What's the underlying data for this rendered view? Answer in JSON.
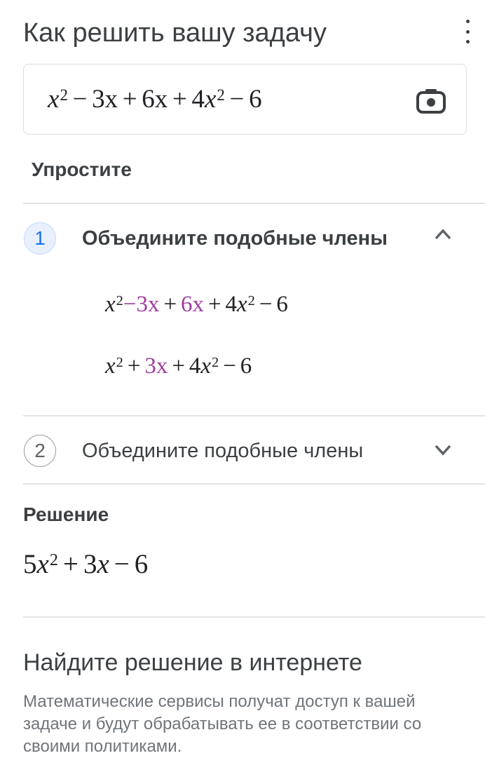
{
  "header": {
    "title": "Как решить вашу задачу",
    "menu_icon": "more-vert-icon"
  },
  "problem": {
    "input_icon": "camera-icon",
    "terms": {
      "t1": "x",
      "e1": "2",
      "op1": "−",
      "t2": "3x",
      "op2": "+",
      "t3": "6x",
      "op3": "+",
      "t4a": "4",
      "t4": "x",
      "e4": "2",
      "op4": "−",
      "t5": "6"
    }
  },
  "task_label": "Упростите",
  "steps": [
    {
      "number": "1",
      "title": "Объедините подобные члены",
      "expanded": true,
      "chevron": "chevron-up-icon",
      "line1": {
        "t1": "x",
        "e1": "2",
        "hl_op": "−",
        "hl_t2": "3x",
        "op2": "+",
        "hl_t3": "6x",
        "op3": "+",
        "t4a": "4",
        "t4": "x",
        "e4": "2",
        "op4": "−",
        "t5": "6"
      },
      "line2": {
        "t1": "x",
        "e1": "2",
        "op1": "+",
        "hl_t2": "3x",
        "op2": "+",
        "t4a": "4",
        "t4": "x",
        "e4": "2",
        "op4": "−",
        "t5": "6"
      }
    },
    {
      "number": "2",
      "title": "Объедините подобные члены",
      "expanded": false,
      "chevron": "chevron-down-icon"
    }
  ],
  "solution": {
    "label": "Решение",
    "expr": {
      "c1": "5",
      "t1": "x",
      "e1": "2",
      "op1": "+",
      "t2a": "3",
      "t2": "x",
      "op2": "−",
      "t3": "6"
    }
  },
  "web": {
    "title": "Найдите решение в интернете",
    "description": "Математические сервисы получат доступ к вашей задаче и будут обрабатывать ее в соответствии со своими политиками."
  },
  "colors": {
    "highlight": "#9c3e9c",
    "step_active": "#1a73e8",
    "text": "#3c4043",
    "divider": "#e3e3e3"
  }
}
